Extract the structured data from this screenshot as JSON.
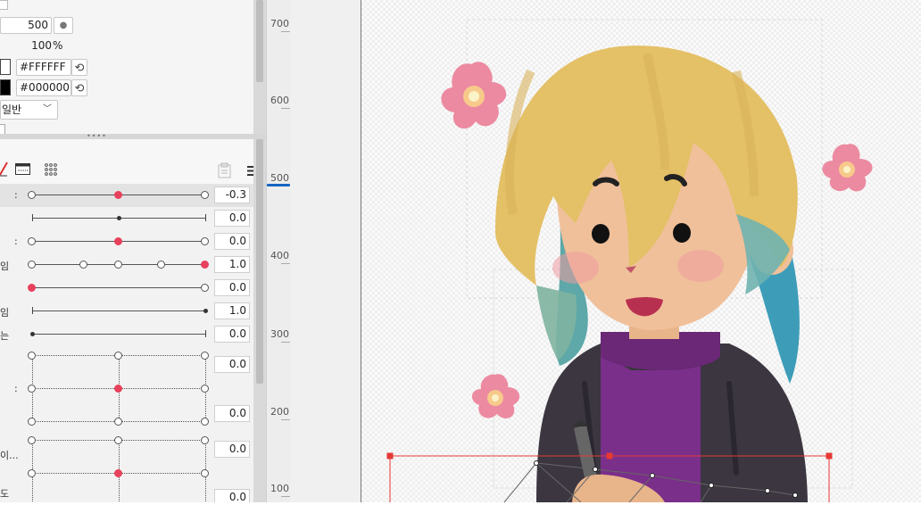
{
  "properties": {
    "size_value": "500",
    "opacity_value": "100",
    "opacity_unit": "%",
    "color1": "#FFFFFF",
    "color2": "#000000",
    "blend_mode_partial": "일반"
  },
  "parameters": {
    "rows": [
      {
        "label": ":",
        "value": "-0.3"
      },
      {
        "label": "",
        "value": "0.0"
      },
      {
        "label": ":",
        "value": "0.0"
      },
      {
        "label": "임",
        "value": "1.0"
      },
      {
        "label": "",
        "value": "0.0"
      },
      {
        "label": "임",
        "value": "1.0"
      },
      {
        "label": "는",
        "value": "0.0"
      }
    ],
    "grid_a": {
      "label": ":",
      "value_top": "0.0",
      "value_bottom": "0.0"
    },
    "grid_b": {
      "label_top": "이...",
      "label_bottom": "도",
      "value_top": "0.0",
      "value_bottom": "0.0"
    }
  },
  "ruler": {
    "labels": [
      "700",
      "600",
      "500",
      "400",
      "300",
      "200",
      "100"
    ]
  },
  "colors": {
    "accent_knob": "#e8415c",
    "ruler_marker": "#1565c0",
    "selection_box": "#e53935"
  },
  "canvas": {
    "content": "illustration-of-girl-with-flowers"
  }
}
